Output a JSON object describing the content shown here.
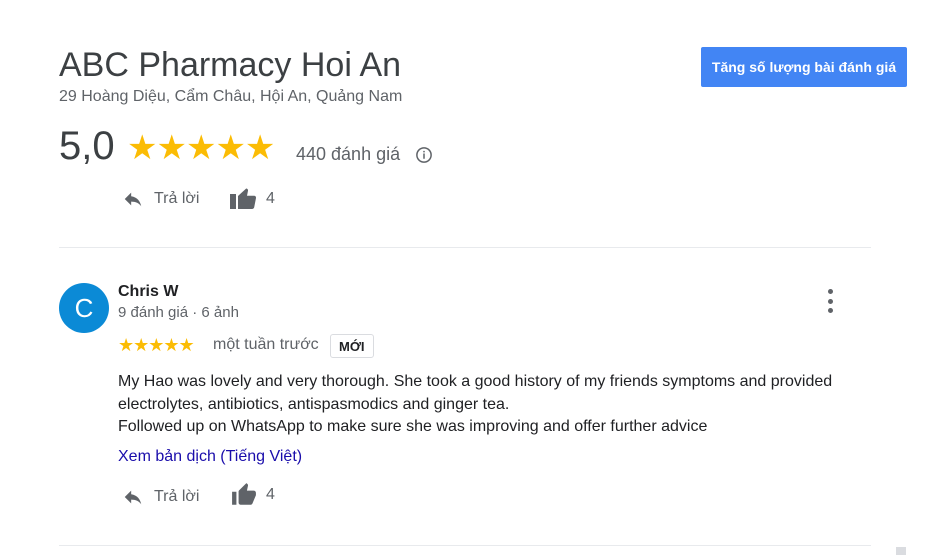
{
  "business": {
    "name": "ABC Pharmacy Hoi An",
    "address": "29 Hoàng Diệu, Cẩm Châu, Hội An, Quảng Nam",
    "rating": "5,0",
    "stars": "★★★★★",
    "review_count": "440 đánh giá",
    "cta_label": "Tăng số lượng bài đánh giá"
  },
  "top_actions": {
    "reply_label": "Trả lời",
    "like_count": "4"
  },
  "review": {
    "avatar_letter": "C",
    "avatar_color": "#0b8ad6",
    "author": "Chris W",
    "author_meta": "9 đánh giá · 6 ảnh",
    "stars": "★★★★★",
    "time": "một tuần trước",
    "badge": "MỚI",
    "text_lines": [
      "My Hao was lovely and very thorough. She took a good history of my friends symptoms and provided electrolytes, antibiotics, antispasmodics and ginger tea.",
      "Followed up on WhatsApp to make sure she was improving and offer further advice"
    ],
    "translate_link": "Xem bản dịch (Tiếng Việt)",
    "reply_label": "Trả lời",
    "like_count": "4"
  },
  "colors": {
    "accent": "#4285f4",
    "star": "#fbbc04",
    "link": "#1a0dab"
  }
}
